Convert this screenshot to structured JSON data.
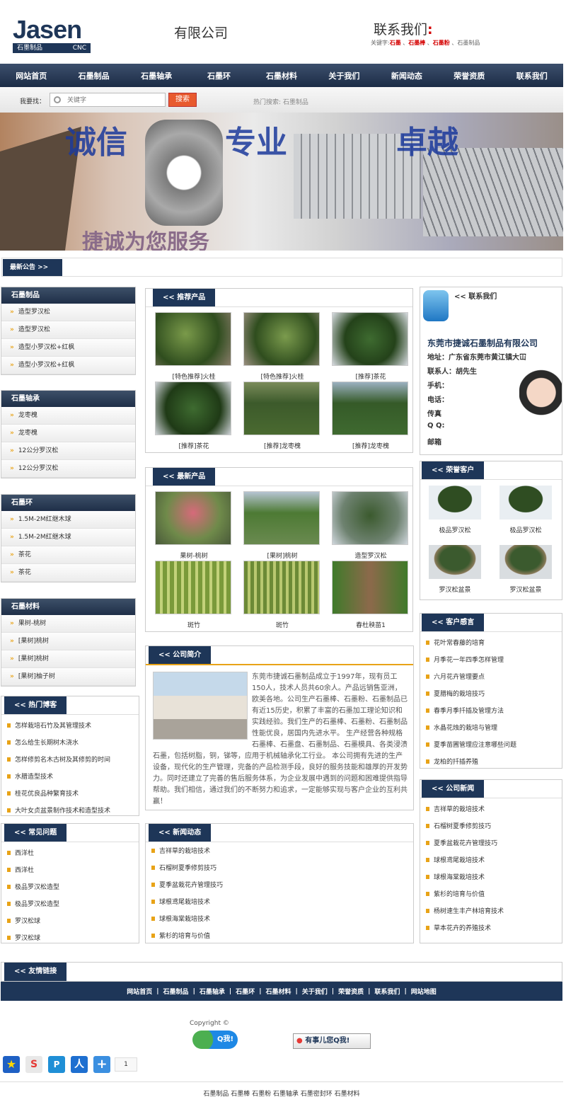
{
  "header": {
    "logo_text": "Jasen",
    "logo_sub_cn": "石墨制品",
    "logo_sub_en": "CNC",
    "company": "有限公司",
    "contact_title": "联系我们",
    "keywords_label": "关键字:",
    "keywords": [
      "石墨",
      "石墨棒",
      "石墨粉"
    ],
    "keyword_last": "石墨制品"
  },
  "nav": [
    "网站首页",
    "石墨制品",
    "石墨轴承",
    "石墨环",
    "石墨材料",
    "关于我们",
    "新闻动态",
    "荣誉资质",
    "联系我们"
  ],
  "search": {
    "label": "我要找：",
    "placeholder": "关键字",
    "button": "搜索",
    "hot": "热门搜索: 石墨制品"
  },
  "banner": {
    "w1": "诚信",
    "w2": "专业",
    "w3": "卓越",
    "slogan": "捷诚为您服务"
  },
  "notice": {
    "title": "最新公告 >>"
  },
  "left": [
    {
      "title": "石墨制品",
      "items": [
        "造型罗汉松",
        "造型罗汉松",
        "造型小罗汉松+红枫",
        "造型小罗汉松+红枫"
      ]
    },
    {
      "title": "石墨轴承",
      "items": [
        "龙枣槐",
        "龙枣槐",
        "12公分罗汉松",
        "12公分罗汉松"
      ]
    },
    {
      "title": "石墨环",
      "items": [
        "1.5M-2M红继木球",
        "1.5M-2M红继木球",
        "茶花",
        "茶花"
      ]
    },
    {
      "title": "石墨材料",
      "items": [
        "果树-桃树",
        "[果树]桃树",
        "[果树]桃树",
        "[果树]柚子树"
      ]
    }
  ],
  "hotblog": {
    "title": "热门博客",
    "items": [
      "怎样栽培石竹及其管理技术",
      "怎么给生长期树木浇水",
      "怎样修剪名木古树及其修剪的时间",
      "水腊造型技术",
      "桂花优良品种繁育技术",
      "大叶女贞盆景制作技术和造型技术"
    ]
  },
  "faq": {
    "title": "常见问题",
    "items": [
      "西洋杜",
      "西洋杜",
      "极品罗汉松造型",
      "极品罗汉松造型",
      "罗汉松球",
      "罗汉松球"
    ]
  },
  "recommend": {
    "title": "推荐产品",
    "items": [
      "[特色推荐]火桂",
      "[特色推荐]火桂",
      "[推荐]茶花",
      "[推荐]茶花",
      "[推荐]龙枣槐",
      "[推荐]龙枣槐"
    ]
  },
  "newest": {
    "title": "最新产品",
    "items": [
      "果树-桃树",
      "[果树]桃树",
      "造型罗汉松",
      "斑竹",
      "斑竹",
      "春杜秧苗1"
    ]
  },
  "intro": {
    "title": "公司简介",
    "text": "东莞市捷诚石墨制品成立于1997年，现有员工150人，技术人员共60余人。产品远销售亚洲，欧美各地。公司生产石墨棒、石墨粉、石墨制品已有近15历史，积累了丰富的石墨加工理论知识和实践经验。我们生产的石墨棒、石墨粉、石墨制品性能优良，居国内先进水平。 生产经营各种规格石墨棒、石墨盘、石墨制品、石墨模具、各类浸渍石墨，包括树脂，铜，锑等，应用于机械轴承化工行业。 本公司拥有先进的生产设备，现代化的生产管理，完备的产品检测手段，良好的服务技能和雄厚的开发势力。同时还建立了完善的售后服务体系，为企业发展中遇到的问题和困难提供指导帮助。我们相信，通过我们的不断努力和追求，一定能够实现与客户企业的互利共赢！"
  },
  "news": {
    "title": "新闻动态",
    "items": [
      "吉祥草的栽培技术",
      "石榴树夏季修剪技巧",
      "夏季盆栽花卉管理技巧",
      "球根鸢尾栽培技术",
      "球根海棠栽培技术",
      "紫杉的培育与价值"
    ]
  },
  "contact": {
    "title": "联系我们",
    "company": "东莞市捷诚石墨制品有限公司",
    "address": "地址：广东省东莞市黄江镇大冚",
    "person": "联系人：胡先生",
    "mobile": "手机：",
    "phone": "电话：",
    "fax": "传真",
    "qq": "Q Q:",
    "email": "邮箱"
  },
  "honor": {
    "title": "荣誉客户",
    "items": [
      "极品罗汉松",
      "极品罗汉松",
      "罗汉松盆景",
      "罗汉松盆景"
    ]
  },
  "feedback": {
    "title": "客户感言",
    "items": [
      "花叶常春藤的培育",
      "月季花一年四季怎样管理",
      "六月花卉管理要点",
      "夏腊梅的栽培技巧",
      "春季月季扦插及管理方法",
      "水晶花烛的栽培与管理",
      "夏季苗圃管理应注意哪些问题",
      "龙柏的扦插养殖"
    ]
  },
  "companynews": {
    "title": "公司新闻",
    "items": [
      "吉祥草的栽培技术",
      "石榴树夏季修剪技巧",
      "夏季盆栽花卉管理技巧",
      "球根鸢尾栽培技术",
      "球根海棠栽培技术",
      "紫杉的培育与价值",
      "杨树速生丰产林培育技术",
      "草本花卉的养殖技术"
    ]
  },
  "links": {
    "title": "友情链接"
  },
  "footer_nav": [
    "网站首页",
    "石墨制品",
    "石墨轴承",
    "石墨环",
    "石墨材料",
    "关于我们",
    "荣誉资质",
    "联系我们",
    "网站地图"
  ],
  "copyright": "Copyright ©",
  "qq_btn": "Q我!",
  "qq_btn2": "有事儿您Q我!",
  "share_count": "1",
  "bottom_keywords": "石墨制品 石墨棒 石墨粉 石墨轴承 石墨密封环 石墨材料"
}
